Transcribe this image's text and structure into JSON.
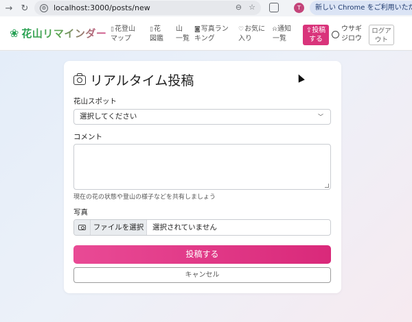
{
  "browser": {
    "url": "localhost:3000/posts/new",
    "profile_initial": "T",
    "notice": "新しい Chrome をご利用いただけます"
  },
  "header": {
    "brand": "花山リマインダー",
    "nav": [
      {
        "icon": "map-icon",
        "line1": "花登山",
        "line2": "マップ"
      },
      {
        "icon": "book-icon",
        "line1": "花",
        "line2": "図鑑"
      },
      {
        "icon": "",
        "line1": "山",
        "line2": "一覧"
      },
      {
        "icon": "camera-icon",
        "line1": "写真ラン",
        "line2": "キング"
      },
      {
        "icon": "heart-icon",
        "line1": "お気に",
        "line2": "入り"
      },
      {
        "icon": "bell-icon",
        "line1": "通知",
        "line2": "一覧"
      }
    ],
    "post_button": {
      "line1": "投稿",
      "line2": "する"
    },
    "user": {
      "line1": "ウサギ",
      "line2": "ジロウ"
    },
    "logout": {
      "line1": "ログア",
      "line2": "ウト"
    }
  },
  "form": {
    "title": "リアルタイム投稿",
    "spot_label": "花山スポット",
    "spot_selected": "選択してください",
    "comment_label": "コメント",
    "comment_value": "",
    "comment_help": "現在の花の状態や登山の様子などを共有しましょう",
    "photo_label": "写真",
    "file_button": "ファイルを選択",
    "file_status": "選択されていません",
    "submit": "投稿する",
    "cancel": "キャンセル"
  },
  "colors": {
    "accent": "#d9347b",
    "brand_green": "#27a055"
  }
}
